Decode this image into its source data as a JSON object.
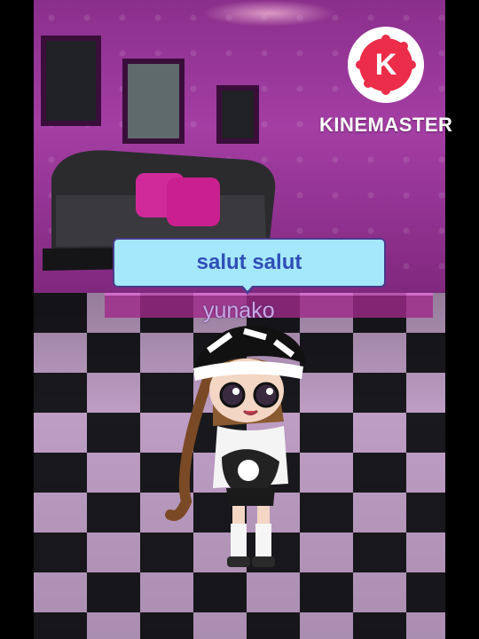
{
  "scene": {
    "speech_bubble_text": "salut salut",
    "character_name": "yunako"
  },
  "watermark": {
    "brand": "KINEMASTER",
    "logo_letter": "K",
    "logo_icon": "kinemaster-logo-icon"
  },
  "colors": {
    "bubble_fill": "#a5e7fb",
    "bubble_text": "#2f4fb8",
    "name_text": "#c9a8e8",
    "wall": "#a43ea4"
  }
}
